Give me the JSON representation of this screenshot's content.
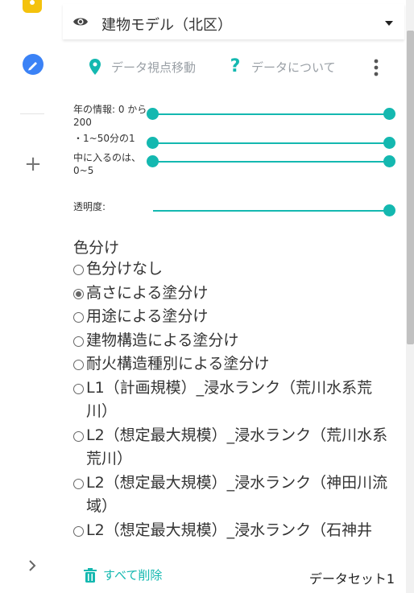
{
  "colors": {
    "accent": "#14b8b0",
    "pencil": "#3b82f6",
    "bulb": "#f4c20d"
  },
  "layer": {
    "title": "建物モデル（北区）"
  },
  "actions": {
    "view_move": "データ視点移動",
    "about": "データについて"
  },
  "sliders": [
    {
      "label": "年の情報: 0 から 200",
      "value": [
        0,
        200
      ]
    },
    {
      "label": "・1~50分の1",
      "value": [
        1,
        50
      ]
    },
    {
      "label": "中に入るのは、0~5",
      "value": [
        0,
        5
      ]
    },
    {
      "label": "透明度:",
      "value": 1
    }
  ],
  "coloring": {
    "title": "色分け",
    "selected_index": 1,
    "options": [
      "色分けなし",
      "高さによる塗分け",
      "用途による塗分け",
      "建物構造による塗分け",
      "耐火構造種別による塗分け",
      "L1（計画規模）_浸水ランク（荒川水系荒川）",
      "L2（想定最大規模）_浸水ランク（荒川水系荒川）",
      "L2（想定最大規模）_浸水ランク（神田川流域）",
      "L2（想定最大規模）_浸水ランク（石神井"
    ]
  },
  "footer": {
    "delete_all": "すべて削除",
    "dataset": "データセット1"
  }
}
